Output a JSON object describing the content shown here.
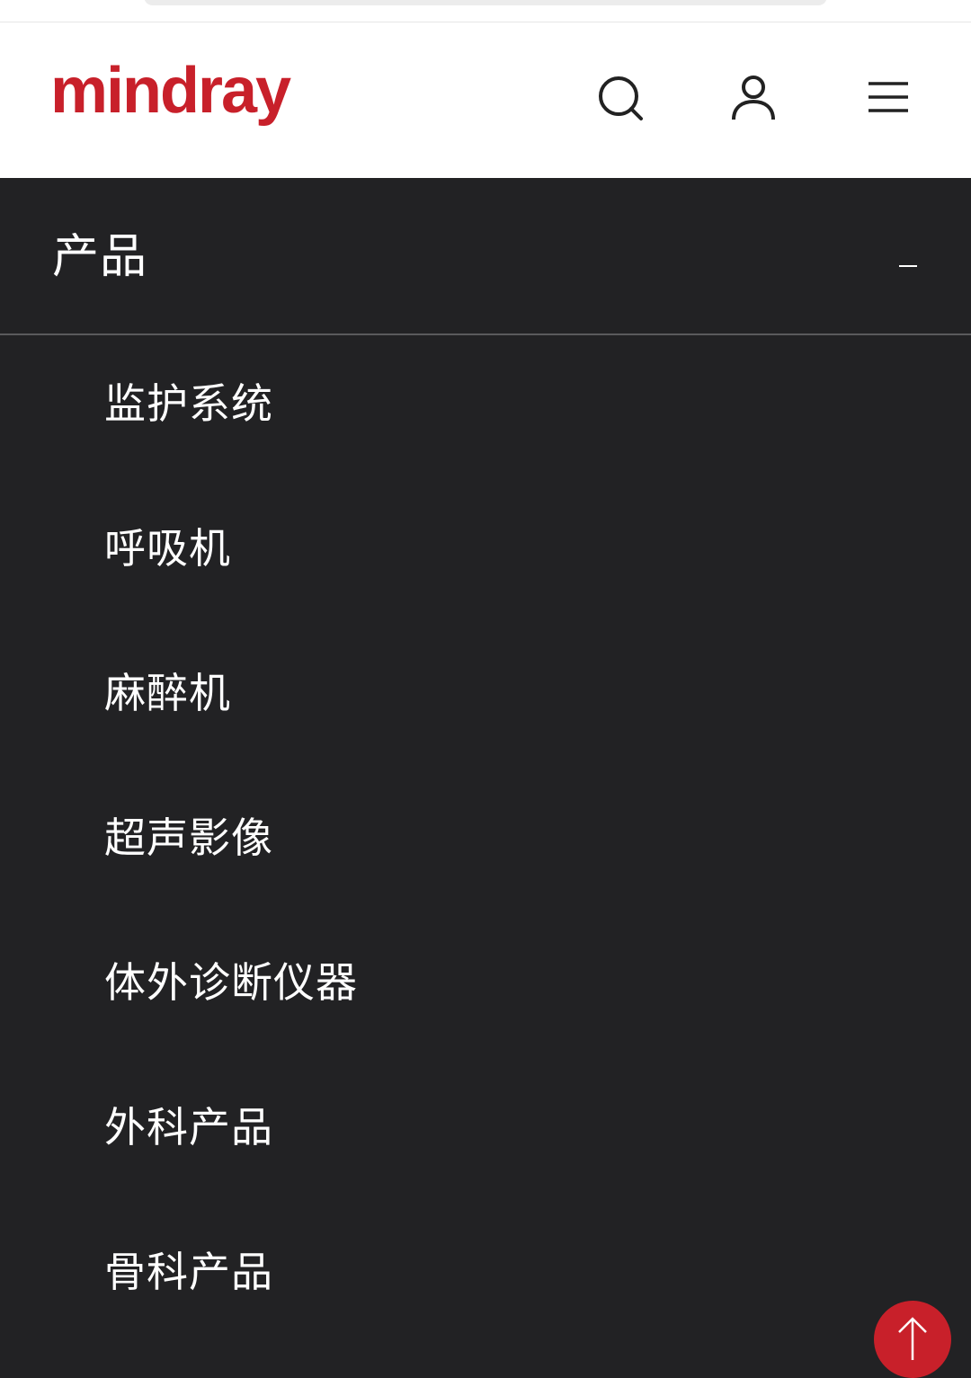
{
  "header": {
    "logo_text": "mindray",
    "brand_color": "#c8202a",
    "icons": [
      "search-icon",
      "user-icon",
      "hamburger-menu-icon"
    ]
  },
  "menu": {
    "section_title": "产品",
    "toggle_symbol": "–",
    "items": [
      {
        "label": "监护系统"
      },
      {
        "label": "呼吸机"
      },
      {
        "label": "麻醉机"
      },
      {
        "label": "超声影像"
      },
      {
        "label": "体外诊断仪器"
      },
      {
        "label": "外科产品"
      },
      {
        "label": "骨科产品"
      }
    ]
  },
  "back_to_top": {
    "icon": "arrow-up-icon",
    "color": "#c8202a"
  },
  "colors": {
    "menu_background": "#222224",
    "header_background": "#ffffff",
    "text": "#ffffff"
  }
}
